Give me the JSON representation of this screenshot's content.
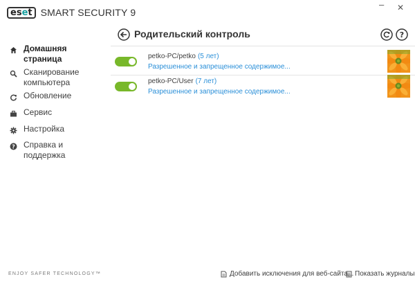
{
  "app": {
    "logo_text": "eset",
    "product_name": "SMART SECURITY 9"
  },
  "window": {
    "minimize_glyph": "–",
    "close_glyph": "✕"
  },
  "sidebar": {
    "items": [
      {
        "label": "Домашняя страница",
        "icon": "home-icon",
        "active": true
      },
      {
        "label": "Сканирование компьютера",
        "icon": "search-icon",
        "active": false
      },
      {
        "label": "Обновление",
        "icon": "refresh-icon",
        "active": false
      },
      {
        "label": "Сервис",
        "icon": "briefcase-icon",
        "active": false
      },
      {
        "label": "Настройка",
        "icon": "gear-icon",
        "active": false
      },
      {
        "label": "Справка и поддержка",
        "icon": "help-icon",
        "active": false
      }
    ]
  },
  "main": {
    "title": "Родительский контроль",
    "accounts": [
      {
        "name": "petko-PC/petko",
        "age": "(5 лет)",
        "link": "Разрешенное и запрещенное содержимое...",
        "enabled": true
      },
      {
        "name": "petko-PC/User",
        "age": "(7 лет)",
        "link": "Разрешенное и запрещенное содержимое...",
        "enabled": true
      }
    ]
  },
  "footer": {
    "tagline": "ENJOY SAFER TECHNOLOGY™",
    "add_exception_label": "Добавить исключения для веб-сайта...",
    "show_logs_label": "Показать журналы"
  },
  "colors": {
    "accent": "#2a8fd8",
    "toggle_on": "#78b82a",
    "brand_teal": "#18a0a0"
  }
}
